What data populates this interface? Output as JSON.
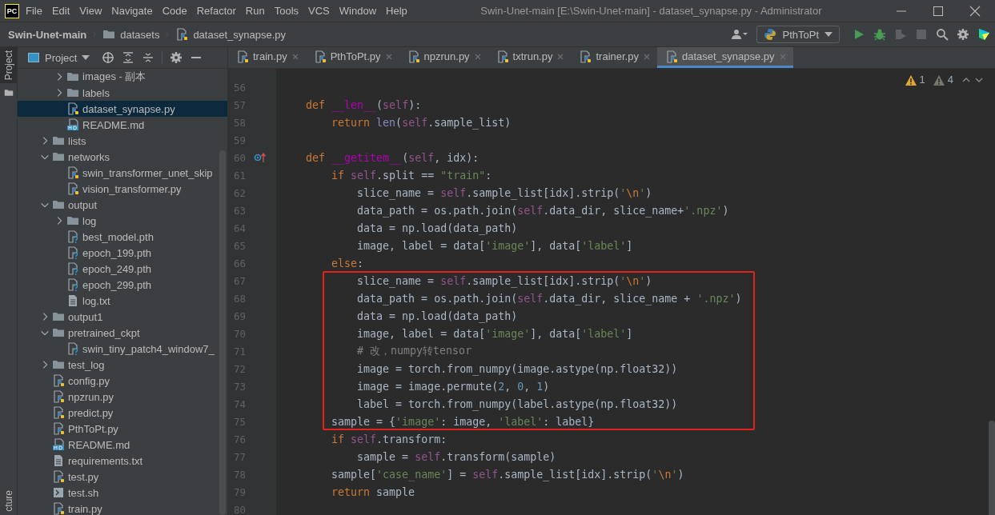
{
  "app_logo": "PC",
  "menu": [
    "File",
    "Edit",
    "View",
    "Navigate",
    "Code",
    "Refactor",
    "Run",
    "Tools",
    "VCS",
    "Window",
    "Help"
  ],
  "window": {
    "title": "Swin-Unet-main [E:\\Swin-Unet-main] - dataset_synapse.py - Administrator"
  },
  "breadcrumb": [
    {
      "label": "Swin-Unet-main",
      "kind": "project"
    },
    {
      "label": "datasets",
      "kind": "folder"
    },
    {
      "label": "dataset_synapse.py",
      "kind": "py"
    }
  ],
  "run_config": {
    "label": "PthToPt"
  },
  "side_stripe": {
    "top_tab": "Project",
    "bottom_tab": "cture"
  },
  "project_panel": {
    "title": "Project"
  },
  "tree": {
    "continued_children": [
      {
        "label": "images - 副本",
        "kind": "folder",
        "expanded": false,
        "selected": false
      },
      {
        "label": "labels",
        "kind": "folder",
        "expanded": false,
        "selected": false
      },
      {
        "label": "dataset_synapse.py",
        "kind": "py",
        "selected": true
      },
      {
        "label": "README.md",
        "kind": "md",
        "selected": false
      }
    ],
    "items": [
      {
        "label": "lists",
        "kind": "folder",
        "expanded": false,
        "selected": false
      },
      {
        "label": "networks",
        "kind": "folder",
        "expanded": true,
        "selected": false,
        "children": [
          {
            "label": "swin_transformer_unet_skip",
            "kind": "py",
            "selected": false
          },
          {
            "label": "vision_transformer.py",
            "kind": "py",
            "selected": false
          }
        ]
      },
      {
        "label": "output",
        "kind": "folder",
        "expanded": true,
        "selected": false,
        "children": [
          {
            "label": "log",
            "kind": "folder",
            "expanded": false,
            "selected": false
          },
          {
            "label": "best_model.pth",
            "kind": "unknown",
            "selected": false
          },
          {
            "label": "epoch_199.pth",
            "kind": "unknown",
            "selected": false
          },
          {
            "label": "epoch_249.pth",
            "kind": "unknown",
            "selected": false
          },
          {
            "label": "epoch_299.pth",
            "kind": "unknown",
            "selected": false
          },
          {
            "label": "log.txt",
            "kind": "txt",
            "selected": false
          }
        ]
      },
      {
        "label": "output1",
        "kind": "folder",
        "expanded": false,
        "selected": false
      },
      {
        "label": "pretrained_ckpt",
        "kind": "folder",
        "expanded": true,
        "selected": false,
        "children": [
          {
            "label": "swin_tiny_patch4_window7_",
            "kind": "unknown",
            "selected": false
          }
        ]
      },
      {
        "label": "test_log",
        "kind": "folder",
        "expanded": false,
        "selected": false
      },
      {
        "label": "config.py",
        "kind": "py",
        "selected": false
      },
      {
        "label": "npzrun.py",
        "kind": "py",
        "selected": false
      },
      {
        "label": "predict.py",
        "kind": "py",
        "selected": false
      },
      {
        "label": "PthToPt.py",
        "kind": "py",
        "selected": false
      },
      {
        "label": "README.md",
        "kind": "md",
        "selected": false
      },
      {
        "label": "requirements.txt",
        "kind": "txt",
        "selected": false
      },
      {
        "label": "test.py",
        "kind": "py",
        "selected": false
      },
      {
        "label": "test.sh",
        "kind": "sh",
        "selected": false
      },
      {
        "label": "train.py",
        "kind": "py",
        "selected": false
      }
    ]
  },
  "tabs": [
    {
      "label": "train.py",
      "selected": false
    },
    {
      "label": "PthToPt.py",
      "selected": false
    },
    {
      "label": "npzrun.py",
      "selected": false
    },
    {
      "label": "txtrun.py",
      "selected": false
    },
    {
      "label": "trainer.py",
      "selected": false
    },
    {
      "label": "dataset_synapse.py",
      "selected": true
    }
  ],
  "inspections": [
    {
      "kind": "warning",
      "count": "1"
    },
    {
      "kind": "weak_warning",
      "count": "4"
    }
  ],
  "editor": {
    "segments": [
      {
        "boxed": false,
        "lines": [
          {
            "number": "56"
          },
          {
            "number": "57",
            "tokens": [
              {
                "kind": "keyword",
                "text": "    def"
              },
              {
                "kind": "magic",
                "text": " __len__"
              },
              {
                "kind": "plain",
                "text": "("
              },
              {
                "kind": "self",
                "text": "self"
              },
              {
                "kind": "plain",
                "text": "):"
              }
            ]
          },
          {
            "number": "58",
            "tokens": [
              {
                "kind": "keyword",
                "text": "        return"
              },
              {
                "kind": "builtin",
                "text": " len"
              },
              {
                "kind": "plain",
                "text": "("
              },
              {
                "kind": "self",
                "text": "self"
              },
              {
                "kind": "plain",
                "text": ".sample_list)"
              }
            ]
          },
          {
            "number": "59"
          },
          {
            "number": "60",
            "kind": "override",
            "tokens": [
              {
                "kind": "keyword",
                "text": "    def"
              },
              {
                "kind": "magic",
                "text": " __getitem__"
              },
              {
                "kind": "plain",
                "text": "("
              },
              {
                "kind": "self",
                "text": "self"
              },
              {
                "kind": "plain",
                "text": ", idx):"
              }
            ]
          },
          {
            "number": "61",
            "tokens": [
              {
                "kind": "keyword",
                "text": "        if"
              },
              {
                "kind": "self",
                "text": " self"
              },
              {
                "kind": "plain",
                "text": ".split == "
              },
              {
                "kind": "string",
                "text": "\"train\""
              },
              {
                "kind": "plain",
                "text": ":"
              }
            ]
          },
          {
            "number": "62",
            "tokens": [
              {
                "kind": "plain",
                "text": "            slice_name = "
              },
              {
                "kind": "self",
                "text": "self"
              },
              {
                "kind": "plain",
                "text": ".sample_list[idx].strip("
              },
              {
                "kind": "string",
                "text": "'"
              },
              {
                "kind": "escape",
                "text": "\\n"
              },
              {
                "kind": "string",
                "text": "'"
              },
              {
                "kind": "plain",
                "text": ")"
              }
            ]
          },
          {
            "number": "63",
            "tokens": [
              {
                "kind": "plain",
                "text": "            data_path = os.path.join("
              },
              {
                "kind": "self",
                "text": "self"
              },
              {
                "kind": "plain",
                "text": ".data_dir, slice_name+"
              },
              {
                "kind": "string",
                "text": "'.npz'"
              },
              {
                "kind": "plain",
                "text": ")"
              }
            ]
          },
          {
            "number": "64",
            "tokens": [
              {
                "kind": "plain",
                "text": "            data = np.load(data_path)"
              }
            ]
          },
          {
            "number": "65",
            "tokens": [
              {
                "kind": "plain",
                "text": "            image, label = data["
              },
              {
                "kind": "string",
                "text": "'image'"
              },
              {
                "kind": "plain",
                "text": "], data["
              },
              {
                "kind": "string",
                "text": "'label'"
              },
              {
                "kind": "plain",
                "text": "]"
              }
            ]
          },
          {
            "number": "66",
            "tokens": [
              {
                "kind": "keyword",
                "text": "        else"
              },
              {
                "kind": "plain",
                "text": ":"
              }
            ]
          }
        ]
      },
      {
        "boxed": true,
        "lines": [
          {
            "number": "67",
            "tokens": [
              {
                "kind": "plain",
                "text": "            slice_name = "
              },
              {
                "kind": "self",
                "text": "self"
              },
              {
                "kind": "plain",
                "text": ".sample_list[idx].strip("
              },
              {
                "kind": "string",
                "text": "'"
              },
              {
                "kind": "escape",
                "text": "\\n"
              },
              {
                "kind": "string",
                "text": "'"
              },
              {
                "kind": "plain",
                "text": ")"
              }
            ]
          },
          {
            "number": "68",
            "tokens": [
              {
                "kind": "plain",
                "text": "            data_path = os.path.join("
              },
              {
                "kind": "self",
                "text": "self"
              },
              {
                "kind": "plain",
                "text": ".data_dir, slice_name + "
              },
              {
                "kind": "string",
                "text": "'.npz'"
              },
              {
                "kind": "plain",
                "text": ")"
              }
            ]
          },
          {
            "number": "69",
            "tokens": [
              {
                "kind": "plain",
                "text": "            data = np.load(data_path)"
              }
            ]
          },
          {
            "number": "70",
            "tokens": [
              {
                "kind": "plain",
                "text": "            image, label = data["
              },
              {
                "kind": "string",
                "text": "'image'"
              },
              {
                "kind": "plain",
                "text": "], data["
              },
              {
                "kind": "string",
                "text": "'label'"
              },
              {
                "kind": "plain",
                "text": "]"
              }
            ]
          },
          {
            "number": "71",
            "tokens": [
              {
                "kind": "comment",
                "text": "            # 改，numpy转tensor"
              }
            ]
          },
          {
            "number": "72",
            "tokens": [
              {
                "kind": "plain",
                "text": "            image = torch.from_numpy(image.astype(np.float32))"
              }
            ]
          },
          {
            "number": "73",
            "tokens": [
              {
                "kind": "plain",
                "text": "            image = image.permute("
              },
              {
                "kind": "number",
                "text": "2"
              },
              {
                "kind": "plain",
                "text": ", "
              },
              {
                "kind": "number",
                "text": "0"
              },
              {
                "kind": "plain",
                "text": ", "
              },
              {
                "kind": "number",
                "text": "1"
              },
              {
                "kind": "plain",
                "text": ")"
              }
            ]
          },
          {
            "number": "74",
            "tokens": [
              {
                "kind": "plain",
                "text": "            label = torch.from_numpy(label.astype(np.float32))"
              }
            ]
          },
          {
            "number": "75",
            "tokens": [
              {
                "kind": "plain",
                "text": "        sample = {"
              },
              {
                "kind": "string",
                "text": "'image'"
              },
              {
                "kind": "plain",
                "text": ": image, "
              },
              {
                "kind": "string",
                "text": "'label'"
              },
              {
                "kind": "plain",
                "text": ": label}"
              }
            ]
          }
        ]
      },
      {
        "boxed": false,
        "lines": [
          {
            "number": "76",
            "tokens": [
              {
                "kind": "keyword",
                "text": "        if"
              },
              {
                "kind": "self",
                "text": " self"
              },
              {
                "kind": "plain",
                "text": ".transform:"
              }
            ]
          },
          {
            "number": "77",
            "tokens": [
              {
                "kind": "plain",
                "text": "            sample = "
              },
              {
                "kind": "self",
                "text": "self"
              },
              {
                "kind": "plain",
                "text": ".transform(sample)"
              }
            ]
          },
          {
            "number": "78",
            "tokens": [
              {
                "kind": "plain",
                "text": "        sample["
              },
              {
                "kind": "string",
                "text": "'case_name'"
              },
              {
                "kind": "plain",
                "text": "] = "
              },
              {
                "kind": "self",
                "text": "self"
              },
              {
                "kind": "plain",
                "text": ".sample_list[idx].strip("
              },
              {
                "kind": "string",
                "text": "'"
              },
              {
                "kind": "escape",
                "text": "\\n"
              },
              {
                "kind": "string",
                "text": "'"
              },
              {
                "kind": "plain",
                "text": ")"
              }
            ]
          },
          {
            "number": "79",
            "tokens": [
              {
                "kind": "keyword",
                "text": "        return"
              },
              {
                "kind": "plain",
                "text": " sample"
              }
            ]
          },
          {
            "number": "80"
          }
        ]
      }
    ]
  }
}
